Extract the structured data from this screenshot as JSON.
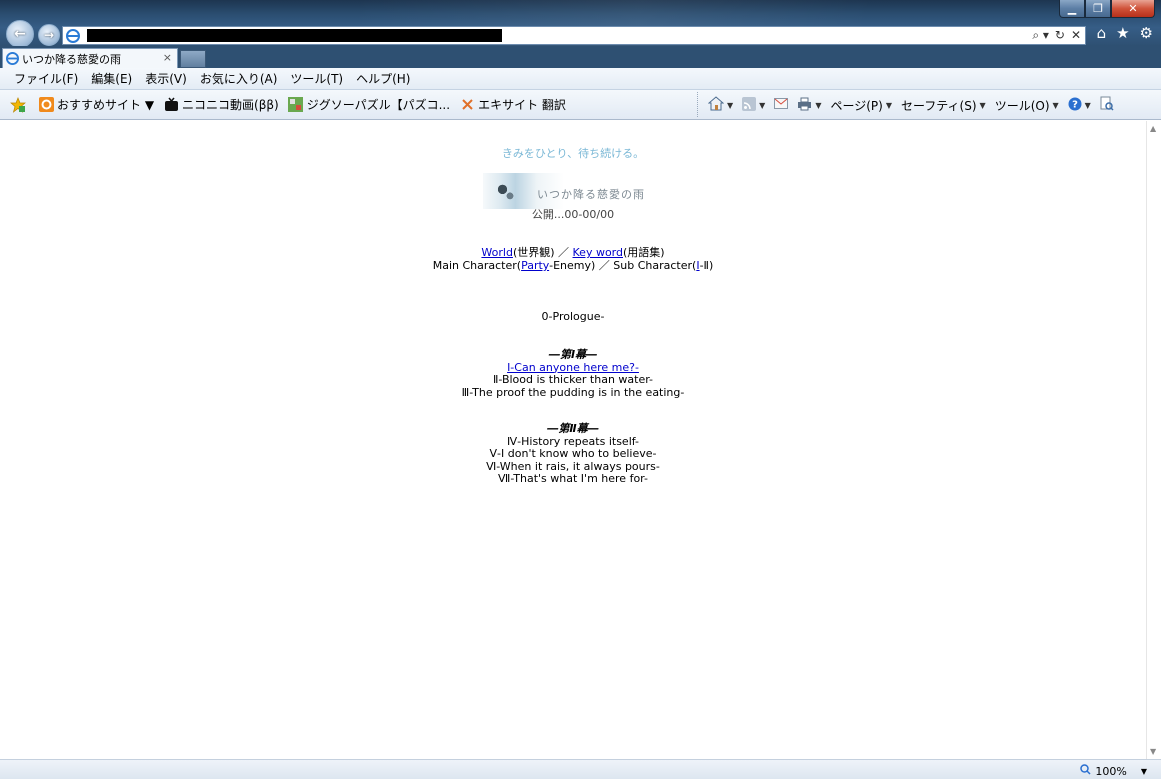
{
  "window": {
    "minimize_glyph": "▁",
    "maximize_glyph": "❐",
    "close_glyph": "✕",
    "address_tool_glyphs": [
      "⌕ ▾",
      "↻",
      "✕"
    ],
    "toolbar_glyphs": [
      "⌂",
      "★",
      "⚙"
    ]
  },
  "tab": {
    "title": "いつか降る慈愛の雨",
    "close_glyph": "×"
  },
  "menubar": {
    "items": [
      "ファイル(F)",
      "編集(E)",
      "表示(V)",
      "お気に入り(A)",
      "ツール(T)",
      "ヘルプ(H)"
    ]
  },
  "favorites": {
    "items": [
      {
        "label": "おすすめサイト ▼"
      },
      {
        "label": "ニコニコ動画(ββ)"
      },
      {
        "label": "ジグソーパズル【パズコ..."
      },
      {
        "label": "エキサイト 翻訳"
      }
    ]
  },
  "command_bar": {
    "page": "ページ(P)",
    "safety": "セーフティ(S)",
    "tools": "ツール(O)"
  },
  "page": {
    "tagline": "きみをひとり、待ち続ける。",
    "banner_text": "いつか降る慈愛の雨",
    "published": "公開...00-00/00",
    "world_link": "World",
    "world_suffix": "(世界観) ／ ",
    "keyword_link": "Key word",
    "keyword_suffix": "(用語集)",
    "main_char_prefix": "Main Character(",
    "party_link": "Party",
    "main_char_suffix": "-Enemy) ／ Sub Character(",
    "sub_link": "Ⅰ",
    "sub_suffix": "-Ⅱ)",
    "prologue": "0-Prologue-",
    "act1": {
      "heading": "―第Ⅰ幕―",
      "chapters": [
        {
          "text": "Ⅰ-Can anyone here me?-",
          "link": true
        },
        {
          "text": "Ⅱ-Blood is thicker than water-",
          "link": false
        },
        {
          "text": "Ⅲ-The proof the pudding is in the eating-",
          "link": false
        }
      ]
    },
    "act2": {
      "heading": "―第Ⅱ幕―",
      "chapters": [
        {
          "text": "Ⅳ-History repeats itself-"
        },
        {
          "text": "Ⅴ-I don't know who to believe-"
        },
        {
          "text": "Ⅵ-When it rais, it always pours-"
        },
        {
          "text": "Ⅶ-That's what I'm here for-"
        }
      ]
    }
  },
  "status": {
    "zoom": "100%"
  }
}
